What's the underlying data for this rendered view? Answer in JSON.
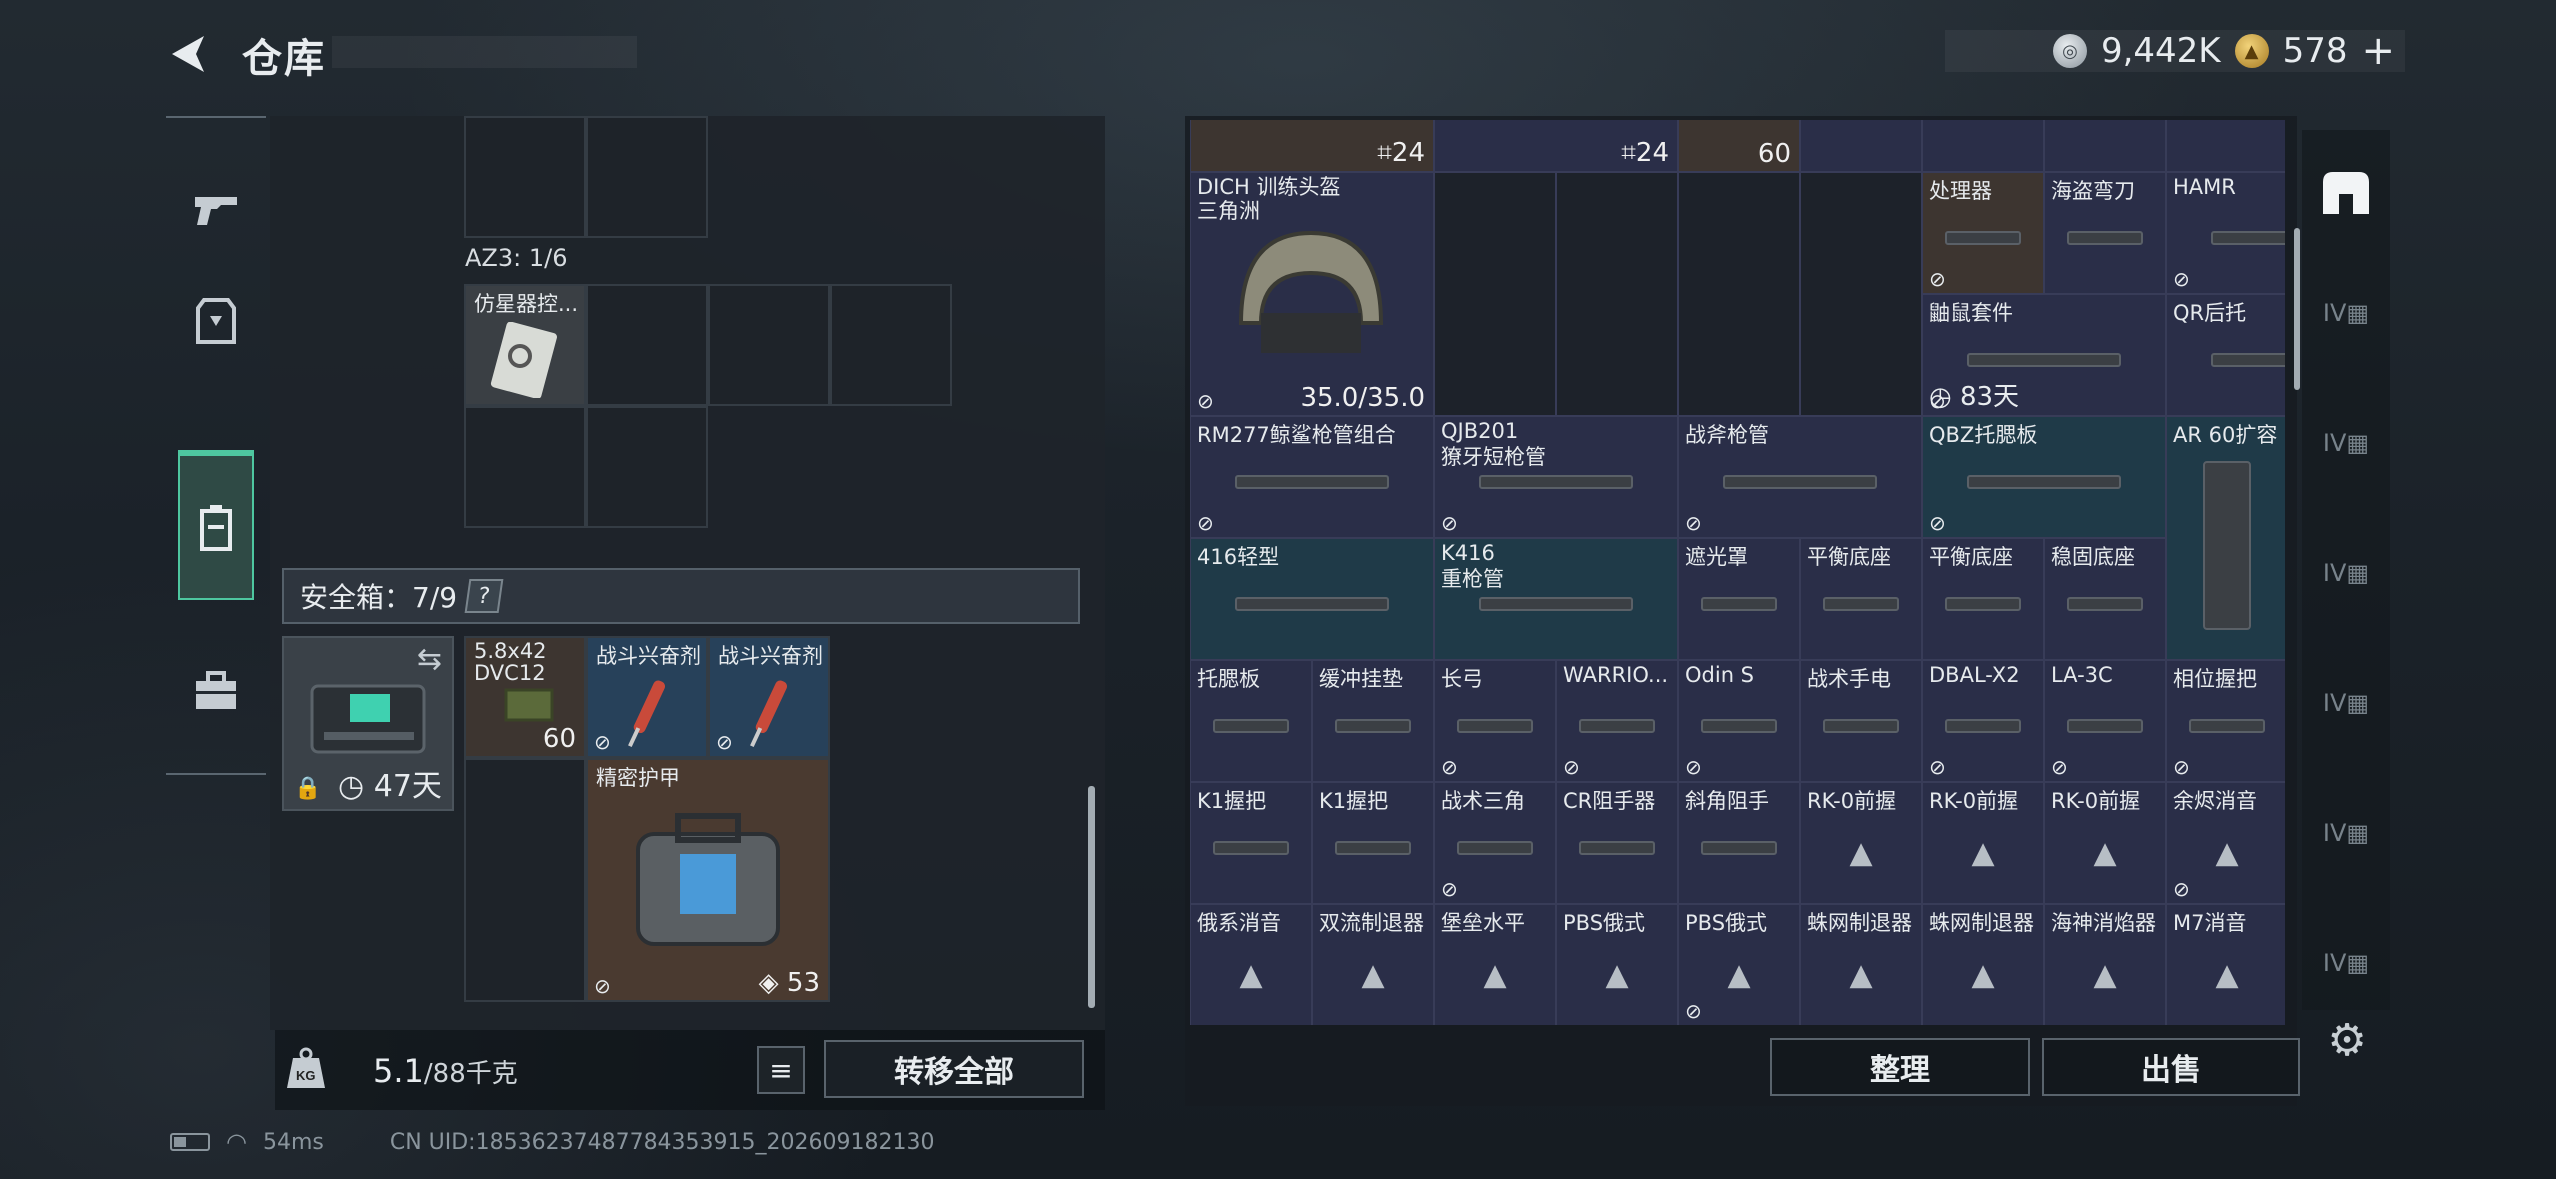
{
  "header": {
    "title": "仓库",
    "currency1": "9,442K",
    "currency2": "578",
    "plus": "+"
  },
  "left": {
    "az3_label": "AZ3: 1/6",
    "simulator_label": "仿星器控...",
    "safe_label": "安全箱：7/9",
    "safe_help": "?",
    "safe_box_days": "47天",
    "items": [
      {
        "label": "5.8x42 DVC12",
        "count": "60"
      },
      {
        "label": "战斗兴奋剂"
      },
      {
        "label": "战斗兴奋剂"
      },
      {
        "label": "精密护甲",
        "durability": "53"
      }
    ],
    "weight_value": "5.1",
    "weight_max": "/88千克",
    "transfer_all": "转移全部"
  },
  "status": {
    "ping": "54ms",
    "uid": "CN UID:1853623748778435391​5_202609182130"
  },
  "right": {
    "top_counts": [
      "24",
      "24",
      "60"
    ],
    "helmet": {
      "label": "DICH 训练头盔",
      "sub": "三角洲",
      "durability": "35.0/35.0"
    },
    "cells": [
      {
        "r": 1,
        "c": 6,
        "w": 1,
        "h": 1,
        "label": "处理器",
        "cls": "brown",
        "icon": true
      },
      {
        "r": 1,
        "c": 7,
        "w": 1,
        "h": 1,
        "label": "海盗弯刀",
        "cls": ""
      },
      {
        "r": 1,
        "c": 8,
        "w": 2,
        "h": 1,
        "label": "HAMR",
        "cls": "",
        "icon": true
      },
      {
        "r": 2,
        "c": 6,
        "w": 2,
        "h": 1,
        "label": "鼬鼠套件",
        "cls": "",
        "icon": true,
        "days": "83天"
      },
      {
        "r": 2,
        "c": 8,
        "w": 2,
        "h": 1,
        "label": "QR后托",
        "cls": ""
      },
      {
        "r": 3,
        "c": 0,
        "w": 2,
        "h": 1,
        "label": "RM277鲸鲨枪管组合",
        "cls": "",
        "icon": true
      },
      {
        "r": 3,
        "c": 2,
        "w": 2,
        "h": 1,
        "label": "QJB201",
        "sub": "獠牙短枪管",
        "cls": "",
        "icon": true
      },
      {
        "r": 3,
        "c": 4,
        "w": 2,
        "h": 1,
        "label": "战斧枪管",
        "cls": "",
        "icon": true
      },
      {
        "r": 3,
        "c": 6,
        "w": 2,
        "h": 1,
        "label": "QBZ托腮板",
        "cls": "blue",
        "icon": true
      },
      {
        "r": 3,
        "c": 8,
        "w": 1,
        "h": 2,
        "label": "AR 60扩容",
        "cls": "blue"
      },
      {
        "r": 4,
        "c": 0,
        "w": 2,
        "h": 1,
        "label": "416轻型",
        "cls": "blue"
      },
      {
        "r": 4,
        "c": 2,
        "w": 2,
        "h": 1,
        "label": "K416",
        "sub": "重枪管",
        "cls": "blue"
      },
      {
        "r": 4,
        "c": 4,
        "w": 1,
        "h": 1,
        "label": "遮光罩",
        "cls": ""
      },
      {
        "r": 4,
        "c": 5,
        "w": 1,
        "h": 1,
        "label": "平衡底座",
        "cls": ""
      },
      {
        "r": 4,
        "c": 6,
        "w": 1,
        "h": 1,
        "label": "平衡底座",
        "cls": ""
      },
      {
        "r": 4,
        "c": 7,
        "w": 1,
        "h": 1,
        "label": "稳固底座",
        "cls": ""
      },
      {
        "r": 5,
        "c": 0,
        "w": 1,
        "h": 1,
        "label": "托腮板",
        "cls": ""
      },
      {
        "r": 5,
        "c": 1,
        "w": 1,
        "h": 1,
        "label": "缓冲挂垫",
        "cls": ""
      },
      {
        "r": 5,
        "c": 2,
        "w": 1,
        "h": 1,
        "label": "长弓",
        "cls": "",
        "icon": true
      },
      {
        "r": 5,
        "c": 3,
        "w": 1,
        "h": 1,
        "label": "WARRIO...",
        "cls": "",
        "icon": true
      },
      {
        "r": 5,
        "c": 4,
        "w": 1,
        "h": 1,
        "label": "Odin S",
        "cls": "",
        "icon": true
      },
      {
        "r": 5,
        "c": 5,
        "w": 1,
        "h": 1,
        "label": "战术手电",
        "cls": ""
      },
      {
        "r": 5,
        "c": 6,
        "w": 1,
        "h": 1,
        "label": "DBAL-X2",
        "cls": "",
        "icon": true
      },
      {
        "r": 5,
        "c": 7,
        "w": 1,
        "h": 1,
        "label": "LA-3C",
        "cls": "",
        "icon": true
      },
      {
        "r": 5,
        "c": 8,
        "w": 1,
        "h": 1,
        "label": "相位握把",
        "cls": "",
        "icon": true
      },
      {
        "r": 6,
        "c": 0,
        "w": 1,
        "h": 1,
        "label": "K1握把",
        "cls": ""
      },
      {
        "r": 6,
        "c": 1,
        "w": 1,
        "h": 1,
        "label": "K1握把",
        "cls": ""
      },
      {
        "r": 6,
        "c": 2,
        "w": 1,
        "h": 1,
        "label": "战术三角",
        "cls": "",
        "icon": true
      },
      {
        "r": 6,
        "c": 3,
        "w": 1,
        "h": 1,
        "label": "CR阻手器",
        "cls": ""
      },
      {
        "r": 6,
        "c": 4,
        "w": 1,
        "h": 1,
        "label": "斜角阻手",
        "cls": ""
      },
      {
        "r": 6,
        "c": 5,
        "w": 1,
        "h": 1,
        "label": "RK-0前握",
        "cls": "",
        "tri": true
      },
      {
        "r": 6,
        "c": 6,
        "w": 1,
        "h": 1,
        "label": "RK-0前握",
        "cls": "",
        "tri": true
      },
      {
        "r": 6,
        "c": 7,
        "w": 1,
        "h": 1,
        "label": "RK-0前握",
        "cls": "",
        "tri": true
      },
      {
        "r": 6,
        "c": 8,
        "w": 1,
        "h": 1,
        "label": "余烬消音",
        "cls": "",
        "tri": true,
        "icon": true
      },
      {
        "r": 7,
        "c": 0,
        "w": 1,
        "h": 1,
        "label": "俄系消音",
        "cls": "",
        "tri": true
      },
      {
        "r": 7,
        "c": 1,
        "w": 1,
        "h": 1,
        "label": "双流制退器",
        "cls": "",
        "tri": true
      },
      {
        "r": 7,
        "c": 2,
        "w": 1,
        "h": 1,
        "label": "堡垒水平",
        "cls": "",
        "tri": true
      },
      {
        "r": 7,
        "c": 3,
        "w": 1,
        "h": 1,
        "label": "PBS俄式",
        "cls": "",
        "tri": true
      },
      {
        "r": 7,
        "c": 4,
        "w": 1,
        "h": 1,
        "label": "PBS俄式",
        "cls": "",
        "tri": true,
        "icon": true
      },
      {
        "r": 7,
        "c": 5,
        "w": 1,
        "h": 1,
        "label": "蛛网制退器",
        "cls": "",
        "tri": true
      },
      {
        "r": 7,
        "c": 6,
        "w": 1,
        "h": 1,
        "label": "蛛网制退器",
        "cls": "",
        "tri": true
      },
      {
        "r": 7,
        "c": 7,
        "w": 1,
        "h": 1,
        "label": "海神消焰器",
        "cls": "",
        "tri": true
      },
      {
        "r": 7,
        "c": 8,
        "w": 1,
        "h": 1,
        "label": "M7消音",
        "cls": "",
        "tri": true
      }
    ],
    "sort": "整理",
    "sell": "出售"
  },
  "icons": {
    "tri": "▲",
    "clock": "◷",
    "shield": "◈",
    "lock": "🔒",
    "gear": "⚙",
    "list": "≡",
    "swap": "⇆",
    "kg": "KG"
  }
}
